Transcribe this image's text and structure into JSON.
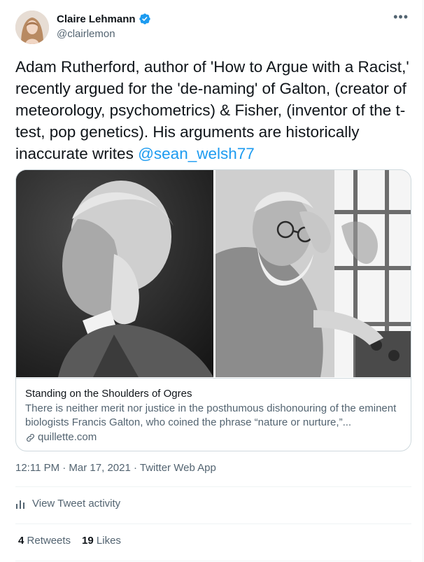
{
  "author": {
    "name": "Claire Lehmann",
    "handle": "@clairlemon",
    "verified": true
  },
  "more_icon": "•••",
  "tweet": {
    "text": "Adam Rutherford, author of 'How to Argue with a Racist,' recently argued for the 'de-naming' of Galton, (creator of meteorology, psychometrics) & Fisher, (inventor of the t-test, pop genetics). His arguments are historically inaccurate writes ",
    "mention": "@sean_welsh77"
  },
  "link_card": {
    "title": "Standing on the Shoulders of Ogres",
    "description": "There is neither merit nor justice in the posthumous dishonouring of the eminent biologists Francis Galton, who coined the phrase “nature or nurture,”...",
    "domain": "quillette.com"
  },
  "meta": {
    "time": "12:11 PM · Mar 17, 2021 · Twitter Web App"
  },
  "activity_label": "View Tweet activity",
  "stats": {
    "retweets_count": "4",
    "retweets_label": "Retweets",
    "likes_count": "19",
    "likes_label": "Likes"
  },
  "colors": {
    "accent": "#1d9bf0",
    "text": "#0f1419",
    "secondary": "#536471",
    "border": "#cfd9de"
  }
}
